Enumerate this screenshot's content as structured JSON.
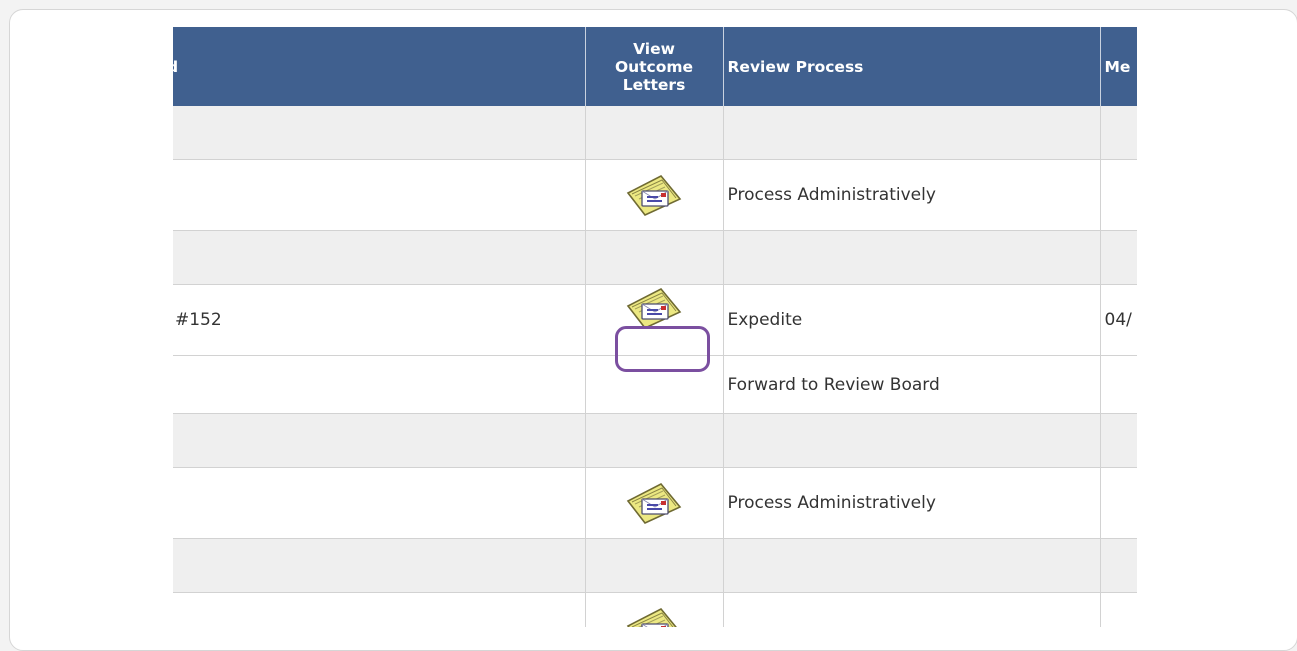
{
  "table": {
    "headers": {
      "col1_partial": "d",
      "view_outcome": [
        "View",
        "Outcome",
        "Letters"
      ],
      "review_process": "Review Process",
      "col4_partial": "Me"
    },
    "rows": [
      {
        "type": "group"
      },
      {
        "type": "data",
        "col1": "",
        "icon": "letter-envelope-icon",
        "review": "Process Administratively",
        "col4": ""
      },
      {
        "type": "group"
      },
      {
        "type": "data",
        "col1": "#152",
        "icon": "letter-envelope-icon",
        "review": "Expedite",
        "col4": "04/"
      },
      {
        "type": "data",
        "col1": "",
        "icon": null,
        "review": "Forward to Review Board",
        "col4": ""
      },
      {
        "type": "group"
      },
      {
        "type": "data",
        "col1": "",
        "icon": "letter-envelope-icon",
        "review": "Process Administratively",
        "col4": ""
      },
      {
        "type": "group"
      },
      {
        "type": "data",
        "col1": "",
        "icon": "letter-envelope-icon",
        "review": "",
        "col4": ""
      }
    ]
  },
  "colors": {
    "header_bg": "#40608f",
    "group_row_bg": "#efefef",
    "highlight": "#7b4fa0",
    "folder": "#ece882"
  }
}
